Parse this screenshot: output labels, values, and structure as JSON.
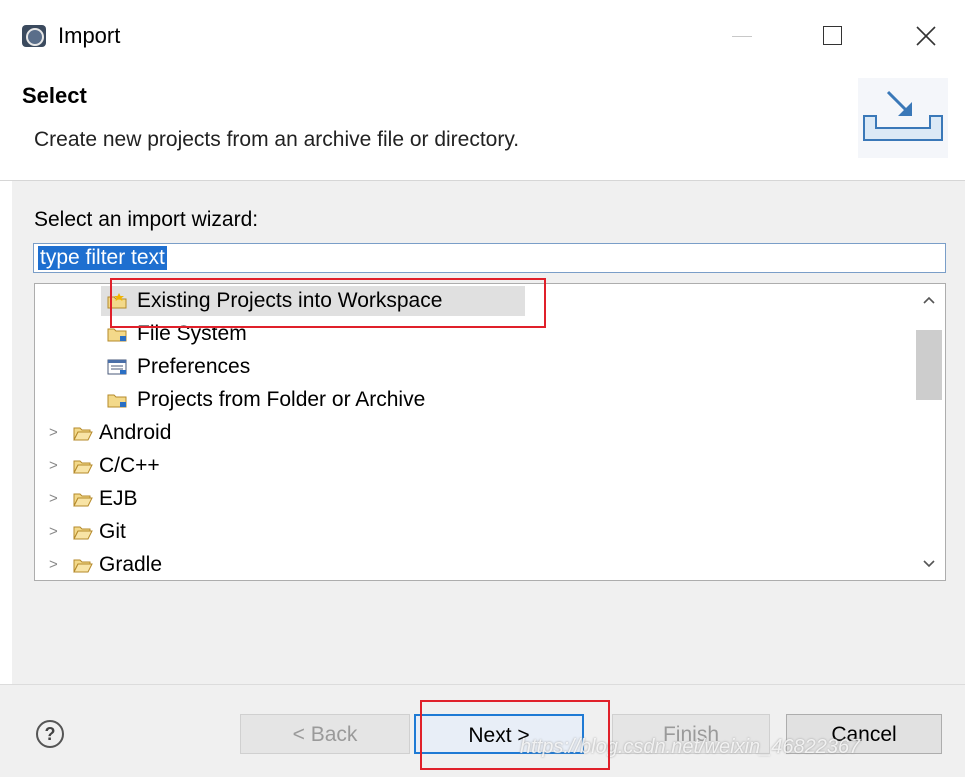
{
  "window": {
    "title": "Import"
  },
  "header": {
    "title": "Select",
    "description": "Create new projects from an archive file or directory."
  },
  "wizard": {
    "label": "Select an import wizard:",
    "filter_value": "type filter text",
    "items": [
      {
        "label": "Existing Projects into Workspace",
        "icon": "project-import-icon",
        "expandable": false,
        "selected": true
      },
      {
        "label": "File System",
        "icon": "folder-icon",
        "expandable": false,
        "selected": false
      },
      {
        "label": "Preferences",
        "icon": "preferences-icon",
        "expandable": false,
        "selected": false
      },
      {
        "label": "Projects from Folder or Archive",
        "icon": "folder-icon",
        "expandable": false,
        "selected": false
      },
      {
        "label": "Android",
        "icon": "open-folder-icon",
        "expandable": true,
        "selected": false
      },
      {
        "label": "C/C++",
        "icon": "open-folder-icon",
        "expandable": true,
        "selected": false
      },
      {
        "label": "EJB",
        "icon": "open-folder-icon",
        "expandable": true,
        "selected": false
      },
      {
        "label": "Git",
        "icon": "open-folder-icon",
        "expandable": true,
        "selected": false
      },
      {
        "label": "Gradle",
        "icon": "open-folder-icon",
        "expandable": true,
        "selected": false
      }
    ]
  },
  "buttons": {
    "help": "?",
    "back": "< Back",
    "next": "Next >",
    "finish": "Finish",
    "cancel": "Cancel"
  },
  "watermark": "https://blog.csdn.net/weixin_46822367",
  "colors": {
    "highlight_red": "#e0202a",
    "selection_blue": "#1e6fd0",
    "default_button_border": "#1f7ad4"
  }
}
